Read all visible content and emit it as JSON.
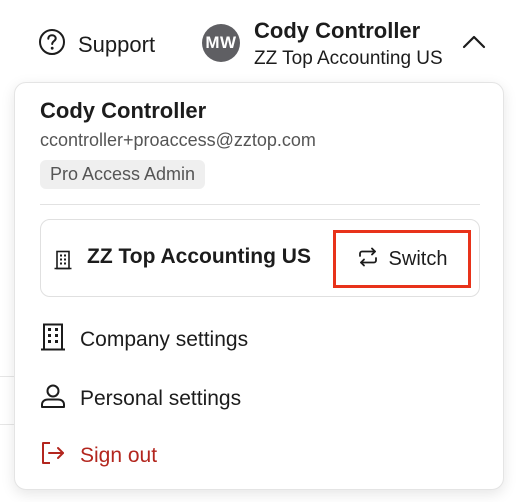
{
  "header": {
    "support_label": "Support",
    "avatar_initials": "MW",
    "user_name": "Cody Controller",
    "company_name": "ZZ Top Accounting US"
  },
  "account_menu": {
    "user_name": "Cody Controller",
    "email": "ccontroller+proaccess@zztop.com",
    "role": "Pro Access Admin",
    "current_company": {
      "name": "ZZ Top Accounting US",
      "switch_label": "Switch"
    },
    "items": [
      {
        "label": "Company settings",
        "icon": "building-icon"
      },
      {
        "label": "Personal settings",
        "icon": "person-icon"
      },
      {
        "label": "Sign out",
        "icon": "sign-out-icon"
      }
    ]
  },
  "colors": {
    "highlight": "#e8321a",
    "sign_out": "#b3261e",
    "avatar_bg": "#5f5f63",
    "badge_bg": "#efefef"
  }
}
